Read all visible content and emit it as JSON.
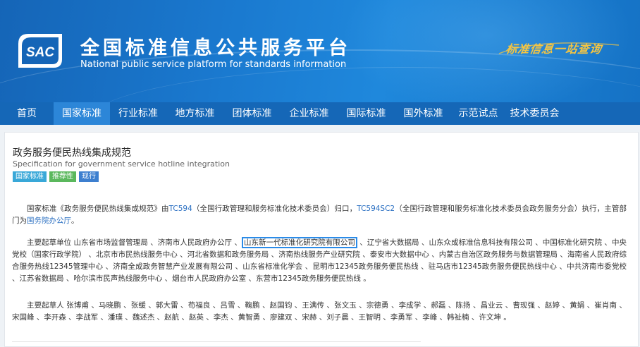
{
  "header": {
    "logo_text": "SAC",
    "title": "全国标准信息公共服务平台",
    "subtitle": "National public service platform  for standards information",
    "slogan": "标准信息一站查询"
  },
  "nav": {
    "items": [
      "首页",
      "国家标准",
      "行业标准",
      "地方标准",
      "团体标准",
      "企业标准",
      "国际标准",
      "国外标准",
      "示范试点",
      "技术委员会"
    ],
    "active": "国家标准"
  },
  "doc": {
    "title": "政务服务便民热线集成规范",
    "subtitle": "Specification for government service hotline integration",
    "tags": [
      "国家标准",
      "推荐性",
      "现行"
    ]
  },
  "p1": {
    "a": "国家标准《政务服务便民热线集成规范》由",
    "link1": "TC594",
    "b": "（全国行政管理和服务标准化技术委员会）归口，",
    "link2": "TC594SC2",
    "c": "（全国行政管理和服务标准化技术委员会政务服务分会）执行，主管部门为",
    "link3": "国务院办公厅",
    "d": "。"
  },
  "p2": {
    "a": "主要起草单位 山东省市场监督管理局 、济南市人民政府办公厅 、",
    "highlight": "山东新一代标准化研究院有限公司",
    "b": " 、辽宁省大数据局 、山东众成标准信息科技有限公司 、中国标准化研究院 、中央党校（国家行政学院） 、北京市市民热线服务中心 、河北省数据和政务服务局 、济南热线服务产业研究院 、泰安市大数据中心 、内蒙古自治区政务服务与数据管理局 、海南省人民政府综合服务热线12345管理中心 、济南全成政务智慧产业发展有限公司 、山东省标准化学会 、昆明市12345政务服务便民热线 、驻马店市12345政务服务便民热线中心 、中共济南市委党校 、江苏省数据局 、哈尔滨市民声热线服务中心 、烟台市人民政府办公室 、东营市12345政务服务便民热线 。"
  },
  "p3": {
    "text": "主要起草人 张博甫 、马晓鹏 、张缓 、郭大雷 、苟福良 、吕雪 、鞠鹏 、赵国钧 、王满传 、张文玉 、宗德勇 、李成学 、郝磊 、陈扬 、昌业云 、曹现强 、赵婷 、黄娟 、崔肖南 、宋国峰 、李开森 、李战军 、潘璞 、魏述杰 、赵航 、赵英 、李杰 、黄智勇 、廖建双 、宋赫 、刘子晨 、王智明 、李勇军 、李峰 、韩祉楠 、许文坤 。"
  },
  "colors": {
    "banner": "#1a79cf",
    "nav": "#1567b7",
    "nav_active": "#2c86d8",
    "link": "#2a6fc2",
    "highlight_border": "#2a8be8",
    "slogan": "#f5c542"
  }
}
